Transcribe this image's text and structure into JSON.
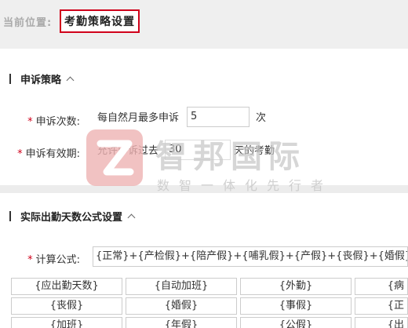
{
  "breadcrumb": {
    "label": "当前位置:",
    "title": "考勤策略设置"
  },
  "appeal_section": {
    "title": "申诉策略",
    "count_label": "申诉次数:",
    "count_prefix": "每自然月最多申诉",
    "count_value": "5",
    "count_suffix": "次",
    "period_label": "申诉有效期:",
    "period_prefix": "允许申诉过去",
    "period_value": "30",
    "period_suffix": "天的考勤"
  },
  "formula_section": {
    "title": "实际出勤天数公式设置",
    "calc_label": "计算公式:",
    "formula_value": "{正常}+{产检假}+{陪产假}+{哺乳假}+{产假}+{丧假}+{婚假}+{调休}",
    "variables": [
      [
        "{应出勤天数}",
        "{自动加班}",
        "{外勤}",
        "{病"
      ],
      [
        "{丧假}",
        "{婚假}",
        "{事假}",
        "{正"
      ],
      [
        "{加班}",
        "{年假}",
        "{公假}",
        "{出"
      ]
    ]
  },
  "watermark": {
    "name": "智邦国际",
    "tagline": "数智一体化先行者"
  },
  "colors": {
    "required_star": "#d0021b",
    "highlight_border": "#d0021b",
    "watermark_logo": "#e8a0a0"
  }
}
